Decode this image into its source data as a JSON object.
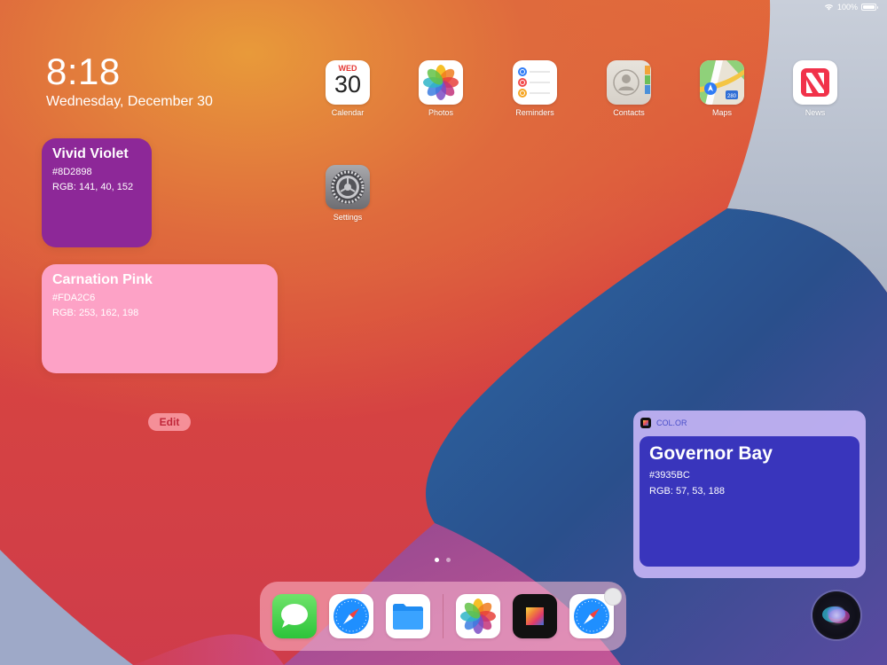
{
  "status_bar": {
    "battery": "100%",
    "wifi_icon": "wifi-icon",
    "battery_level": 1.0
  },
  "lock": {
    "time": "8:18",
    "date": "Wednesday, December 30"
  },
  "widgets": {
    "violet": {
      "name": "Vivid Violet",
      "hex": "#8D2898",
      "rgb": "RGB: 141, 40, 152",
      "color": "#8D2898"
    },
    "pink": {
      "name": "Carnation Pink",
      "hex": "#FDA2C6",
      "rgb": "RGB: 253, 162, 198",
      "color": "#FDA2C6"
    },
    "edit_label": "Edit"
  },
  "apps": {
    "calendar": {
      "label": "Calendar",
      "day": "WED",
      "date": "30",
      "icon": "calendar-icon"
    },
    "photos": {
      "label": "Photos",
      "icon": "photos-icon"
    },
    "reminders": {
      "label": "Reminders",
      "icon": "reminders-icon"
    },
    "contacts": {
      "label": "Contacts",
      "icon": "contacts-icon"
    },
    "maps": {
      "label": "Maps",
      "icon": "maps-icon",
      "route": "280"
    },
    "news": {
      "label": "News",
      "icon": "news-icon"
    },
    "settings": {
      "label": "Settings",
      "icon": "settings-icon"
    }
  },
  "color_widget": {
    "app_name": "COL.OR",
    "name": "Governor Bay",
    "hex": "#3935BC",
    "rgb": "RGB: 57, 53, 188",
    "color": "#3935BC"
  },
  "page_dots": {
    "count": 2,
    "active_index": 0
  },
  "dock": {
    "apps": [
      {
        "name": "Messages",
        "icon": "messages-icon"
      },
      {
        "name": "Safari",
        "icon": "safari-icon"
      },
      {
        "name": "Files",
        "icon": "files-icon"
      },
      {
        "name": "Photos",
        "icon": "photos-icon"
      },
      {
        "name": "Color",
        "icon": "color-app-icon"
      },
      {
        "name": "Safari",
        "icon": "safari-icon"
      }
    ]
  },
  "siri": {
    "icon": "siri-icon"
  }
}
